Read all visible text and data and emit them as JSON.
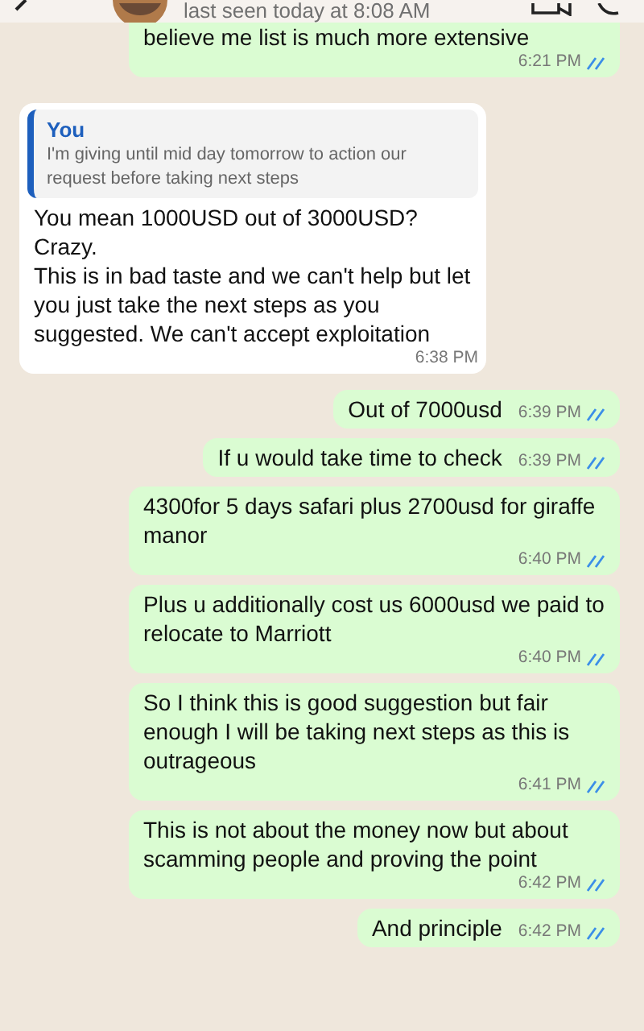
{
  "header": {
    "status": "last seen today at 8:08 AM"
  },
  "messages": [
    {
      "kind": "outgoing",
      "text": "believe me list is much more extensive",
      "time": "6:21 PM",
      "read": true
    },
    {
      "kind": "incoming",
      "quote": {
        "author": "You",
        "text": "I'm giving until mid day tomorrow to action our request before taking next steps"
      },
      "text": "You mean 1000USD out of 3000USD?\nCrazy.\nThis is in bad taste and we can't help but let you just take the next steps as you suggested. We can't accept exploitation",
      "time": "6:38 PM"
    },
    {
      "kind": "outgoing",
      "text": "Out of 7000usd",
      "time": "6:39 PM",
      "read": true
    },
    {
      "kind": "outgoing",
      "text": "If u would take time to check",
      "time": "6:39 PM",
      "read": true
    },
    {
      "kind": "outgoing",
      "text": "4300for 5 days safari plus 2700usd for giraffe manor",
      "time": "6:40 PM",
      "read": true
    },
    {
      "kind": "outgoing",
      "text": "Plus u additionally cost us 6000usd we paid to relocate to Marriott",
      "time": "6:40 PM",
      "read": true
    },
    {
      "kind": "outgoing",
      "text": "So I think this is good suggestion but fair enough I will be taking next steps as this is outrageous",
      "time": "6:41 PM",
      "read": true
    },
    {
      "kind": "outgoing",
      "text": "This is not about the money now but about scamming people and proving the point",
      "time": "6:42 PM",
      "read": true
    },
    {
      "kind": "outgoing",
      "text": "And principle",
      "time": "6:42 PM",
      "read": true
    }
  ]
}
